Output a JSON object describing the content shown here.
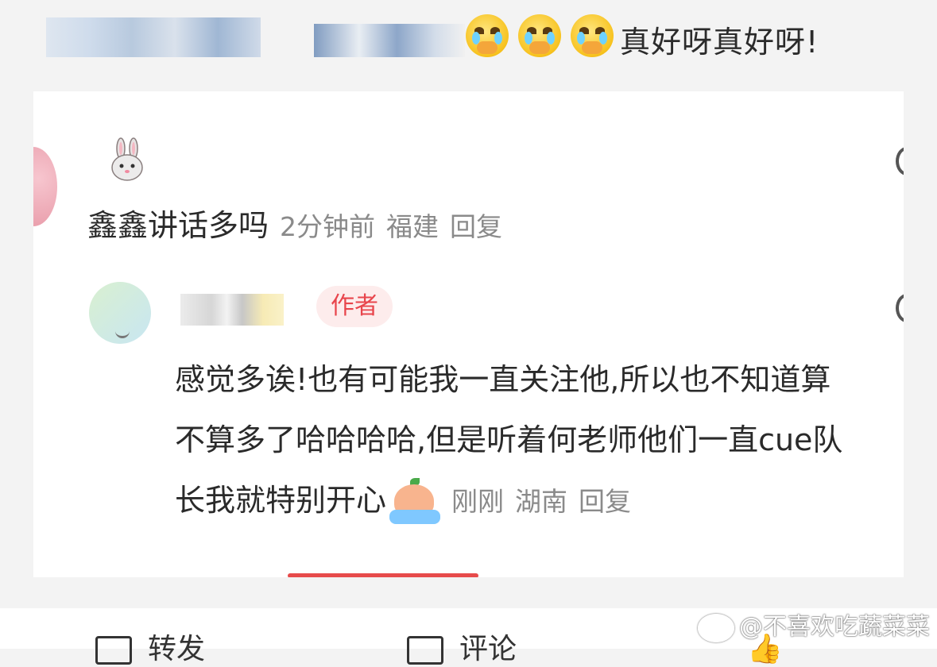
{
  "post": {
    "caption_text": "真好呀真好呀!",
    "emoji_names": [
      "crying-covering-mouth-emoji",
      "crying-covering-mouth-emoji",
      "crying-covering-mouth-emoji"
    ]
  },
  "comments": [
    {
      "text": "鑫鑫讲话多吗",
      "time": "2分钟前",
      "location": "福建",
      "reply_label": "回复",
      "avatar_icon": "bunny-icon"
    },
    {
      "badge": "作者",
      "text": "感觉多诶!也有可能我一直关注他,所以也不知道算不算多了哈哈哈哈,但是听着何老师他们一直cue队长我就特别开心",
      "time": "刚刚",
      "location": "湖南",
      "reply_label": "回复",
      "trailing_icon": "crying-peach-emoji"
    }
  ],
  "actions": {
    "repost_label": "转发",
    "comment_label": "评论"
  },
  "watermark": "@不喜欢吃蔬菜菜",
  "colors": {
    "badge_text": "#e8454c",
    "badge_bg": "#fdecec",
    "meta_text": "#8a8a8a"
  }
}
